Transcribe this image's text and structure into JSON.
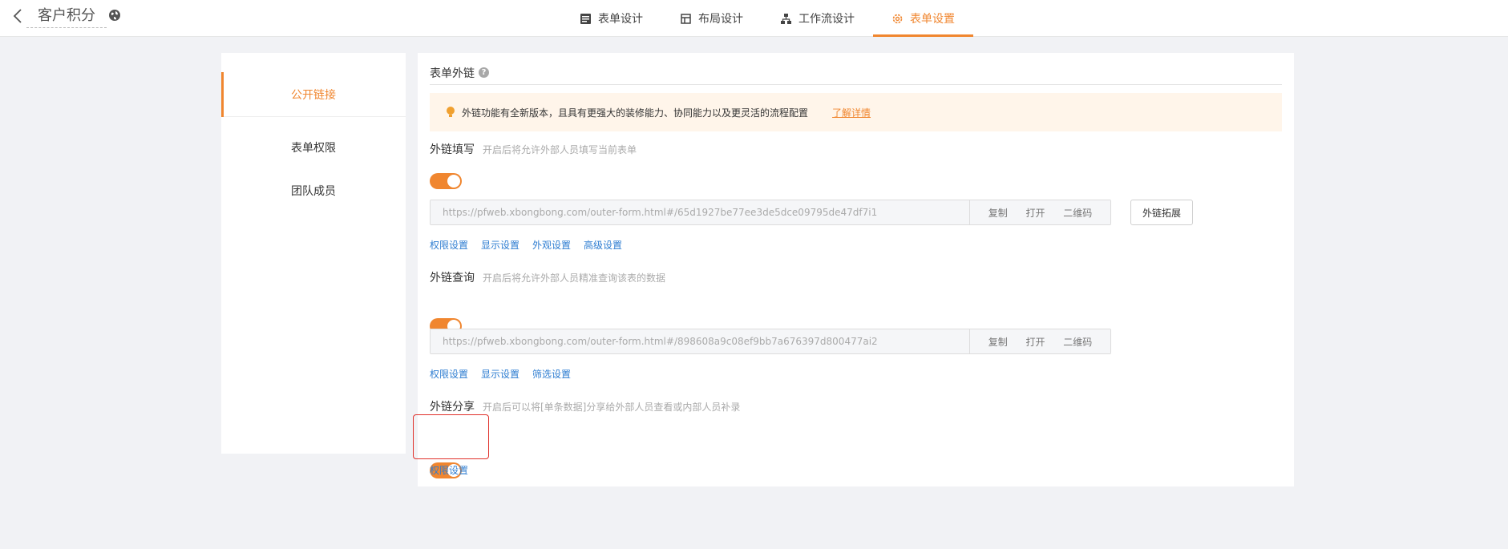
{
  "header": {
    "title": "客户积分",
    "nav": [
      {
        "label": "表单设计",
        "icon": "form-icon"
      },
      {
        "label": "布局设计",
        "icon": "layout-icon"
      },
      {
        "label": "工作流设计",
        "icon": "workflow-icon"
      },
      {
        "label": "表单设置",
        "icon": "gear-icon",
        "active": true
      }
    ]
  },
  "sidebar": {
    "items": [
      {
        "label": "公开链接",
        "active": true
      },
      {
        "label": "表单权限"
      },
      {
        "label": "团队成员"
      }
    ]
  },
  "panel": {
    "section_title": "表单外链",
    "notice": {
      "text": "外链功能有全新版本，且具有更强大的装修能力、协同能力以及更灵活的流程配置",
      "link": "了解详情"
    },
    "fill": {
      "title": "外链填写",
      "hint": "开启后将允许外部人员填写当前表单",
      "enabled": true,
      "url": "https://pfweb.xbongbong.com/outer-form.html#/65d1927be77ee3de5dce09795de47df7i1",
      "actions": [
        "复制",
        "打开",
        "二维码"
      ],
      "extend_button": "外链拓展",
      "links": [
        "权限设置",
        "显示设置",
        "外观设置",
        "高级设置"
      ]
    },
    "query": {
      "title": "外链查询",
      "hint": "开启后将允许外部人员精准查询该表的数据",
      "enabled": true,
      "url": "https://pfweb.xbongbong.com/outer-form.html#/898608a9c08ef9bb7a676397d800477ai2",
      "actions": [
        "复制",
        "打开",
        "二维码"
      ],
      "links": [
        "权限设置",
        "显示设置",
        "筛选设置"
      ]
    },
    "share": {
      "title": "外链分享",
      "hint": "开启后可以将[单条数据]分享给外部人员查看或内部人员补录",
      "enabled": true,
      "links": [
        "权限设置"
      ]
    }
  },
  "colors": {
    "accent": "#f0862f",
    "link": "#2e7dd1",
    "highlight": "#e0302a"
  }
}
